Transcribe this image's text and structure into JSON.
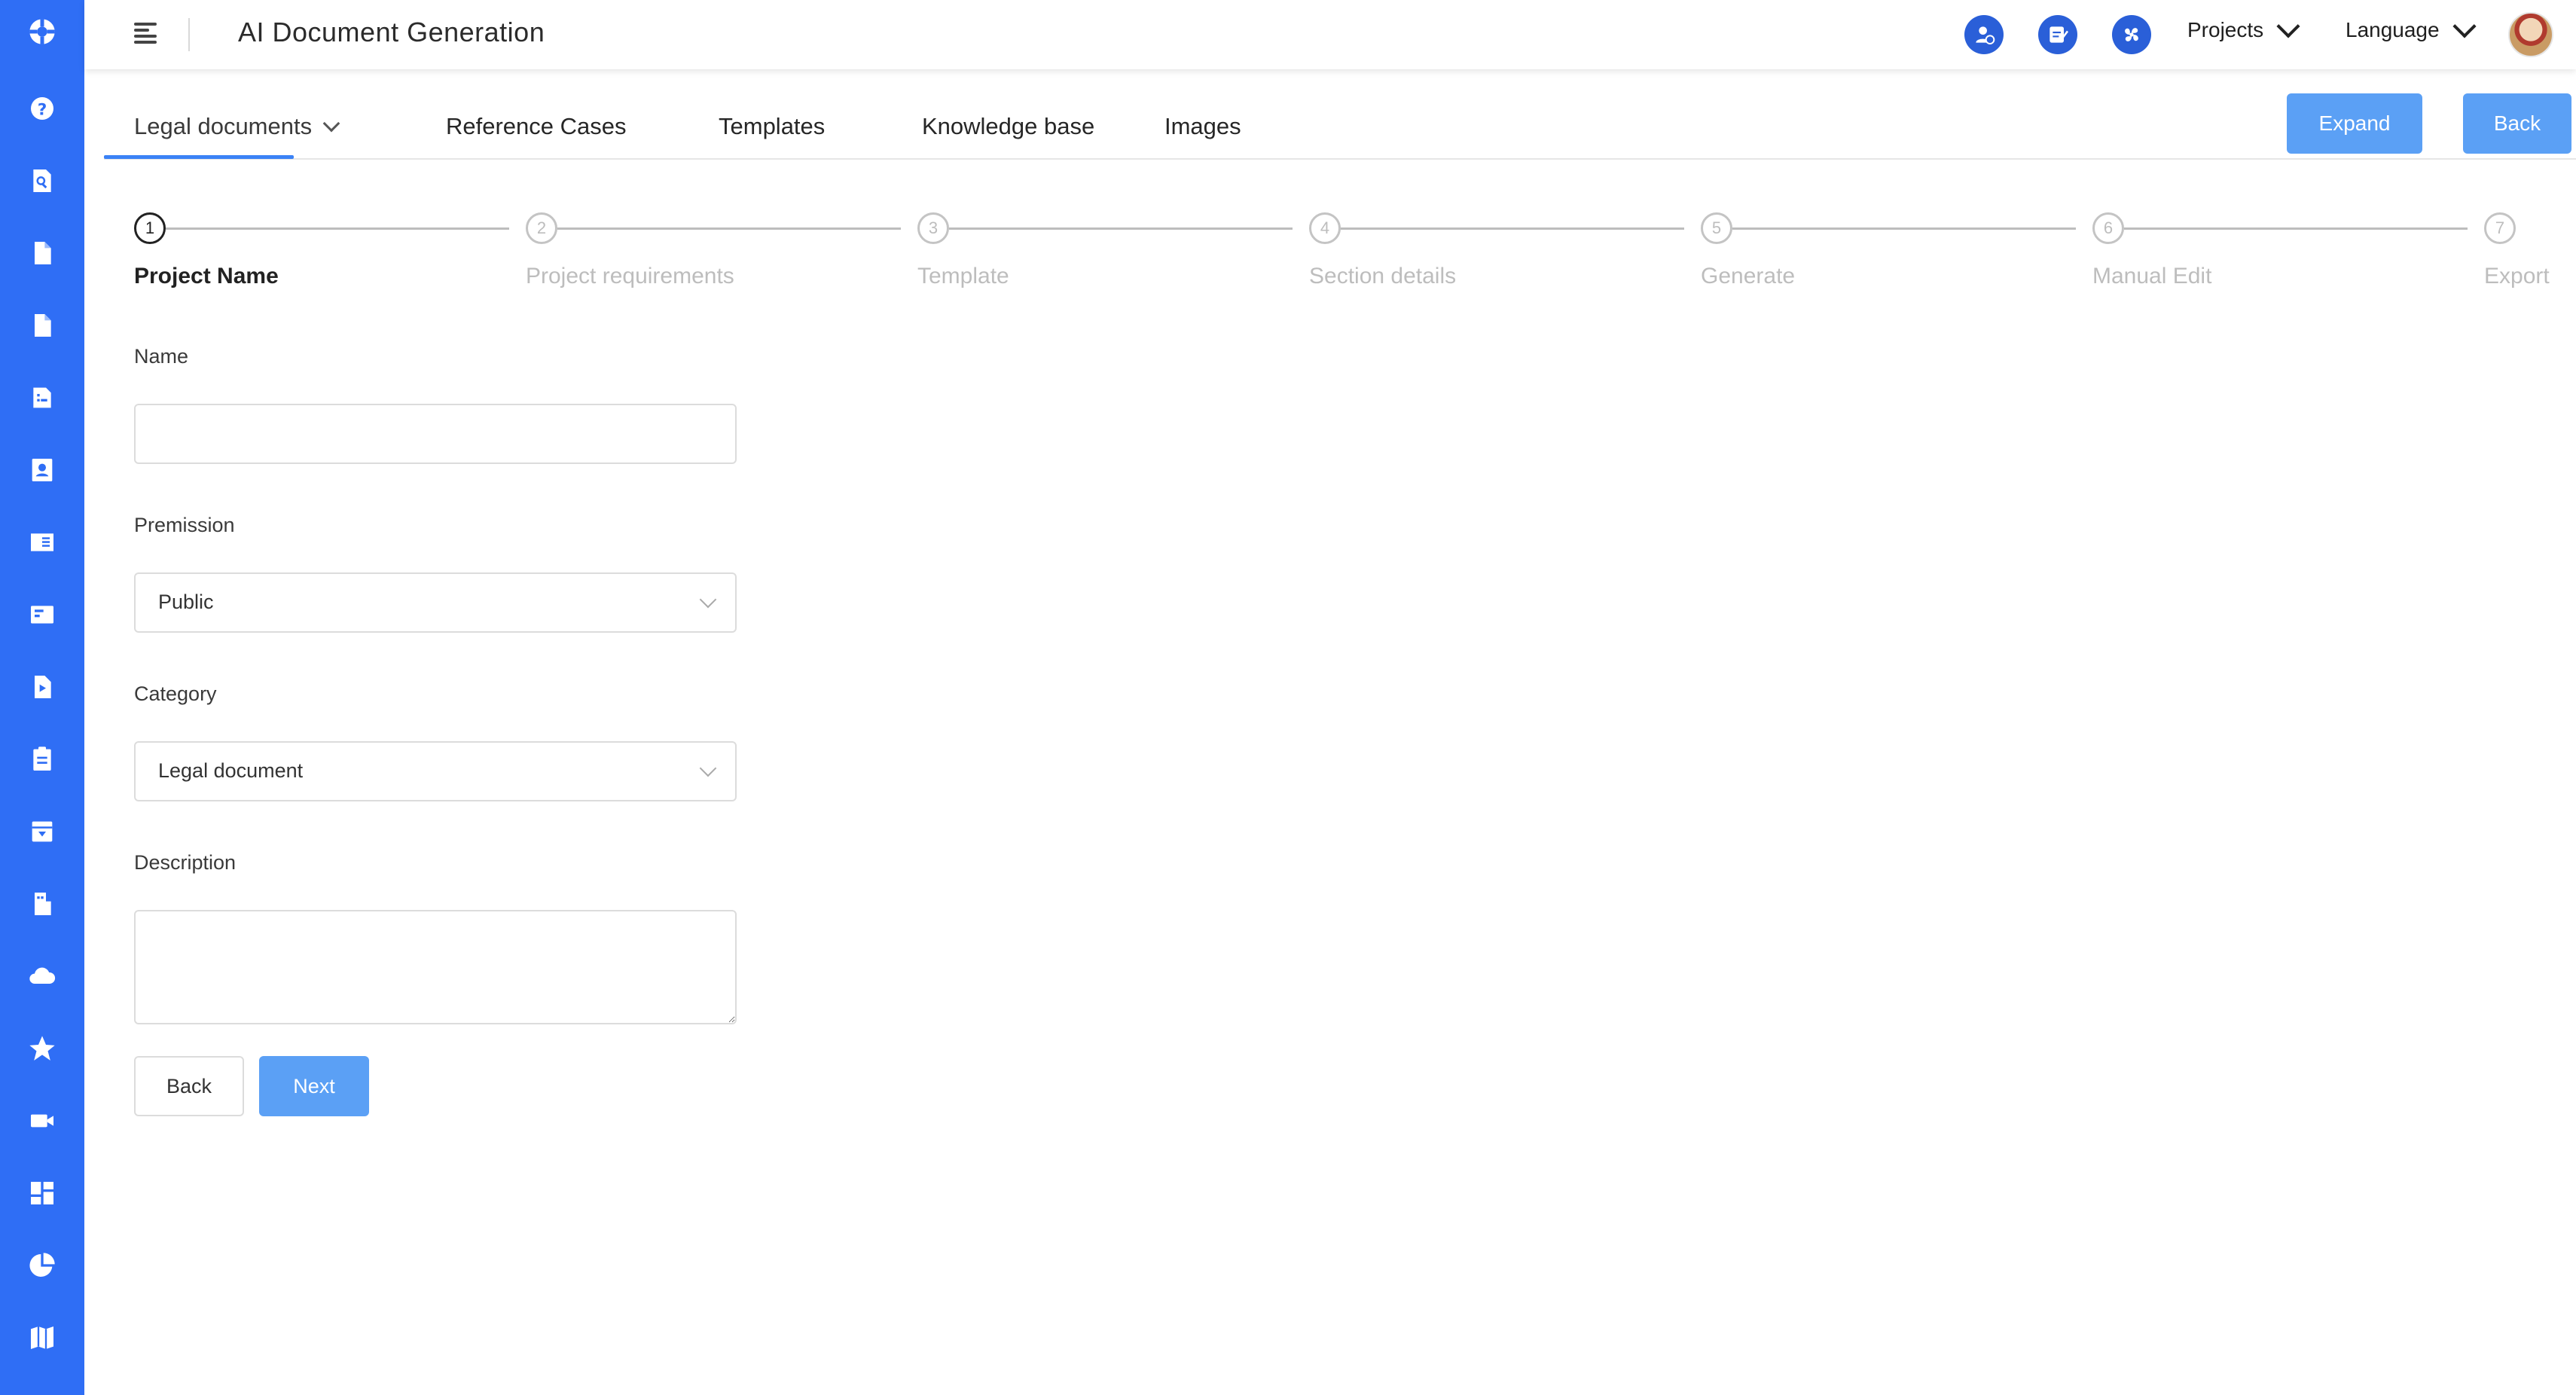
{
  "app": {
    "title": "AI Document Generation"
  },
  "sidebar": {
    "icons": [
      "logo-icon",
      "help-icon",
      "search-document-icon",
      "document-icon",
      "file-icon",
      "report-icon",
      "contact-icon",
      "book-icon",
      "card-icon",
      "play-file-icon",
      "clipboard-icon",
      "archive-icon",
      "building-icon",
      "cloud-icon",
      "star-icon",
      "video-icon",
      "dashboard-icon",
      "pie-chart-icon",
      "map-icon"
    ]
  },
  "header": {
    "icons": [
      "user-add-icon",
      "edit-note-icon",
      "fan-icon"
    ],
    "projects_label": "Projects",
    "language_label": "Language"
  },
  "tabs": [
    {
      "label": "Legal documents",
      "active": true
    },
    {
      "label": "Reference Cases"
    },
    {
      "label": "Templates"
    },
    {
      "label": "Knowledge base"
    },
    {
      "label": "Images"
    }
  ],
  "actions": {
    "expand_label": "Expand",
    "back_label": "Back"
  },
  "stepper": {
    "current": 1,
    "steps": [
      {
        "number": "1",
        "label": "Project Name"
      },
      {
        "number": "2",
        "label": "Project requirements"
      },
      {
        "number": "3",
        "label": "Template"
      },
      {
        "number": "4",
        "label": "Section details"
      },
      {
        "number": "5",
        "label": "Generate"
      },
      {
        "number": "6",
        "label": "Manual Edit"
      },
      {
        "number": "7",
        "label": "Export"
      }
    ]
  },
  "form": {
    "name_label": "Name",
    "name_value": "",
    "permission_label": "Premission",
    "permission_value": "Public",
    "category_label": "Category",
    "category_value": "Legal document",
    "description_label": "Description",
    "description_value": "",
    "back_label": "Back",
    "next_label": "Next"
  },
  "colors": {
    "rail": "#2f6ef5",
    "primary_button": "#5ba0f5",
    "tab_underline": "#3b82f6",
    "header_icon_bg": "#2a5fd8"
  }
}
